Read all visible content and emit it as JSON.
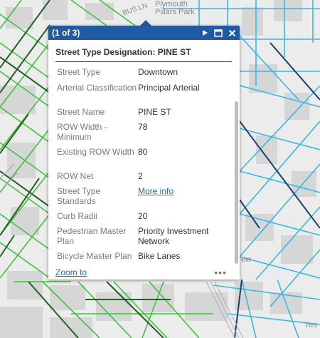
{
  "map": {
    "labels": [
      {
        "text": "BUS LN"
      },
      {
        "text": "Plymouth"
      },
      {
        "text": "Pillars Park"
      },
      {
        "text": "ew"
      },
      {
        "text": "Yes"
      }
    ],
    "colors": {
      "downtown_green": "#3cc23c",
      "dark_green": "#245f24",
      "light_blue": "#38b8e8",
      "dark_blue": "#1c3f6e",
      "background": "#ececec",
      "block": "#d2d2d2"
    }
  },
  "popup": {
    "count": "(1 of 3)",
    "title": "Street Type Designation: PINE ST",
    "icons": {
      "next": "play-arrow-icon",
      "maximize": "maximize-icon",
      "close": "close-icon",
      "more": "more-icon"
    },
    "attributes": [
      {
        "label": "Street Type",
        "value": "Downtown",
        "is_link": false
      },
      {
        "label": "Arterial Classification",
        "value": "Principal Arterial",
        "is_link": false
      },
      {
        "label": "Street Name",
        "value": "PINE ST",
        "is_link": false
      },
      {
        "label": "ROW Width - Minimum",
        "value": "78",
        "is_link": false
      },
      {
        "label": "Existing ROW Width",
        "value": "80",
        "is_link": false
      },
      {
        "label": "ROW Net",
        "value": "2",
        "is_link": false
      },
      {
        "label": "Street Type Standards",
        "value": "More info",
        "is_link": true
      },
      {
        "label": "Curb Radii",
        "value": "20",
        "is_link": false
      },
      {
        "label": "Pedestrian Master Plan",
        "value": "Priority Investment Network",
        "is_link": false
      },
      {
        "label": "Bicycle Master Plan",
        "value": "Bike Lanes",
        "is_link": false
      }
    ],
    "zoom_label": "Zoom to",
    "more_label": "•••",
    "header_color": "#1f5aa3"
  }
}
